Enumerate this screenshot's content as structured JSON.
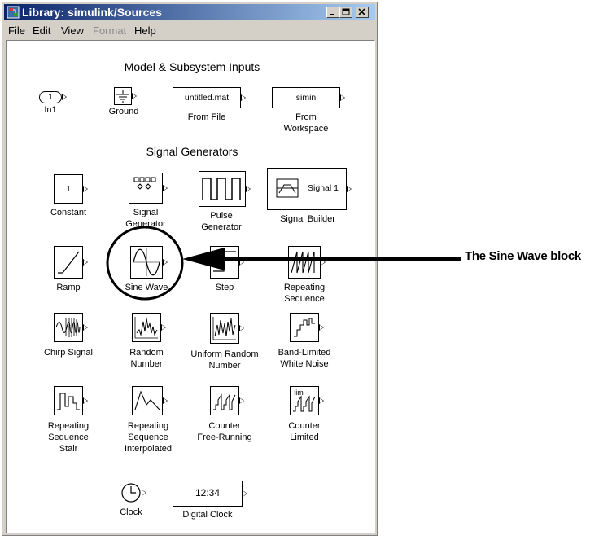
{
  "window": {
    "title": "Library: simulink/Sources",
    "controls": [
      "minimize",
      "maximize",
      "close"
    ]
  },
  "menu": [
    {
      "label": "File",
      "enabled": true
    },
    {
      "label": "Edit",
      "enabled": true
    },
    {
      "label": "View",
      "enabled": true
    },
    {
      "label": "Format",
      "enabled": false
    },
    {
      "label": "Help",
      "enabled": true
    }
  ],
  "sections": {
    "inputs": "Model & Subsystem Inputs",
    "generators": "Signal Generators"
  },
  "blocks": {
    "in1": {
      "label": "In1",
      "text": "1"
    },
    "ground": {
      "label": "Ground"
    },
    "from_file": {
      "label": "From File",
      "text": "untitled.mat"
    },
    "from_workspace": {
      "label_line1": "From",
      "label_line2": "Workspace",
      "text": "simin"
    },
    "constant": {
      "label": "Constant",
      "text": "1"
    },
    "signal_generator": {
      "label_line1": "Signal",
      "label_line2": "Generator"
    },
    "pulse_generator": {
      "label_line1": "Pulse",
      "label_line2": "Generator"
    },
    "signal_builder": {
      "label": "Signal Builder",
      "text": "Signal 1"
    },
    "ramp": {
      "label": "Ramp"
    },
    "sine_wave": {
      "label": "Sine Wave"
    },
    "step": {
      "label": "Step"
    },
    "repeating_sequence": {
      "label_line1": "Repeating",
      "label_line2": "Sequence"
    },
    "chirp_signal": {
      "label": "Chirp Signal"
    },
    "random_number": {
      "label_line1": "Random",
      "label_line2": "Number"
    },
    "uniform_random_number": {
      "label_line1": "Uniform Random",
      "label_line2": "Number"
    },
    "band_limited_white_noise": {
      "label_line1": "Band-Limited",
      "label_line2": "White Noise"
    },
    "repeating_sequence_stair": {
      "label_line1": "Repeating",
      "label_line2": "Sequence",
      "label_line3": "Stair"
    },
    "repeating_sequence_interpolated": {
      "label_line1": "Repeating",
      "label_line2": "Sequence",
      "label_line3": "Interpolated"
    },
    "counter_free_running": {
      "label_line1": "Counter",
      "label_line2": "Free-Running"
    },
    "counter_limited": {
      "label_line1": "Counter",
      "label_line2": "Limited",
      "text": "lim"
    },
    "clock": {
      "label": "Clock"
    },
    "digital_clock": {
      "label": "Digital Clock",
      "text": "12:34"
    }
  },
  "callout": {
    "text": "The Sine Wave block"
  }
}
